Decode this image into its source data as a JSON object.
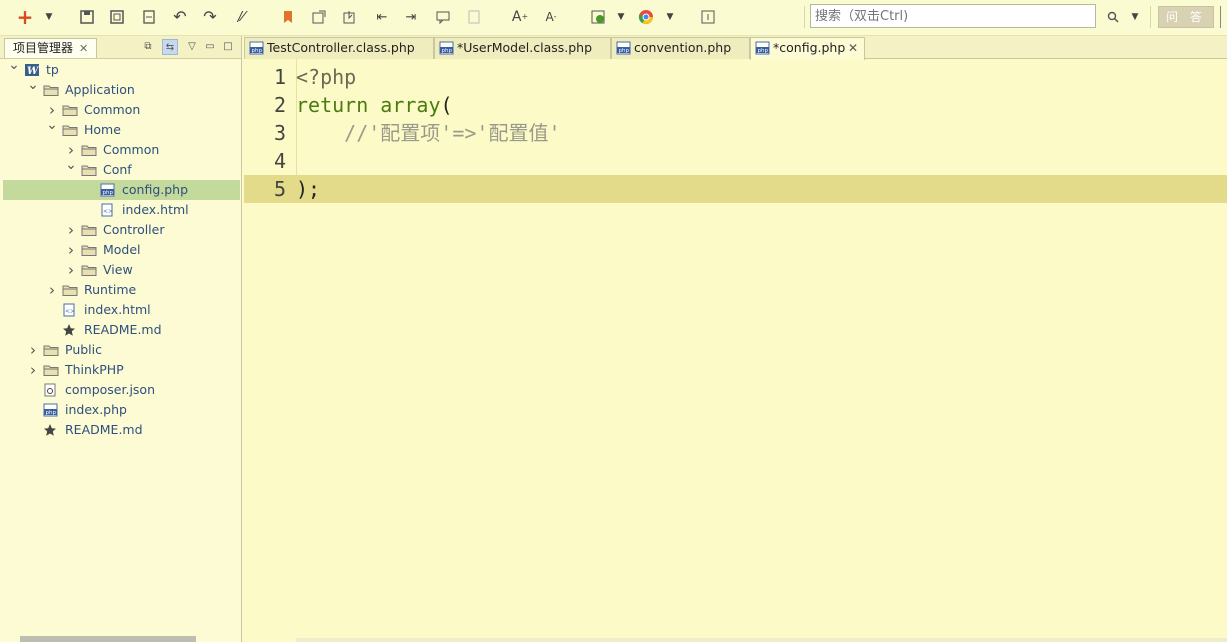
{
  "toolbar": {
    "search_placeholder": "搜索（双击Ctrl)",
    "qa_label": "问 答"
  },
  "left_panel": {
    "tab_label": "项目管理器",
    "tree": [
      {
        "label": "tp",
        "depth": 0,
        "kind": "project",
        "expanded": true
      },
      {
        "label": "Application",
        "depth": 1,
        "kind": "folder",
        "expanded": true
      },
      {
        "label": "Common",
        "depth": 2,
        "kind": "folder",
        "expanded": false
      },
      {
        "label": "Home",
        "depth": 2,
        "kind": "folder",
        "expanded": true
      },
      {
        "label": "Common",
        "depth": 3,
        "kind": "folder",
        "expanded": false
      },
      {
        "label": "Conf",
        "depth": 3,
        "kind": "folder",
        "expanded": true
      },
      {
        "label": "config.php",
        "depth": 4,
        "kind": "php",
        "selected": true
      },
      {
        "label": "index.html",
        "depth": 4,
        "kind": "html"
      },
      {
        "label": "Controller",
        "depth": 3,
        "kind": "folder",
        "expanded": false
      },
      {
        "label": "Model",
        "depth": 3,
        "kind": "folder",
        "expanded": false
      },
      {
        "label": "View",
        "depth": 3,
        "kind": "folder",
        "expanded": false
      },
      {
        "label": "Runtime",
        "depth": 2,
        "kind": "folder",
        "expanded": false
      },
      {
        "label": "index.html",
        "depth": 2,
        "kind": "html"
      },
      {
        "label": "README.md",
        "depth": 2,
        "kind": "md"
      },
      {
        "label": "Public",
        "depth": 1,
        "kind": "folder",
        "expanded": false
      },
      {
        "label": "ThinkPHP",
        "depth": 1,
        "kind": "folder",
        "expanded": false
      },
      {
        "label": "composer.json",
        "depth": 1,
        "kind": "json"
      },
      {
        "label": "index.php",
        "depth": 1,
        "kind": "php"
      },
      {
        "label": "README.md",
        "depth": 1,
        "kind": "md"
      }
    ]
  },
  "editor": {
    "tabs": [
      {
        "label": "TestController.class.php",
        "active": false,
        "closable": false
      },
      {
        "label": "*UserModel.class.php",
        "active": false,
        "closable": false
      },
      {
        "label": "convention.php",
        "active": false,
        "closable": false
      },
      {
        "label": "*config.php",
        "active": true,
        "closable": true
      }
    ],
    "lines": [
      {
        "num": "1",
        "parts": [
          {
            "t": "<?php",
            "c": "kw-php"
          }
        ]
      },
      {
        "num": "2",
        "parts": [
          {
            "t": "return ",
            "c": "kw-green"
          },
          {
            "t": "array",
            "c": "kw-green"
          },
          {
            "t": "(",
            "c": "plain"
          }
        ]
      },
      {
        "num": "3",
        "parts": [
          {
            "t": "    //'配置项'=>'配置值'",
            "c": "cmt"
          }
        ]
      },
      {
        "num": "4",
        "parts": []
      },
      {
        "num": "5",
        "parts": [
          {
            "t": ");",
            "c": "plain"
          }
        ],
        "current": true
      }
    ]
  },
  "colors": {
    "background": "#fbfac8",
    "current_line": "#e3db8a",
    "selection": "#c4d99c",
    "keyword": "#4a7a10"
  }
}
